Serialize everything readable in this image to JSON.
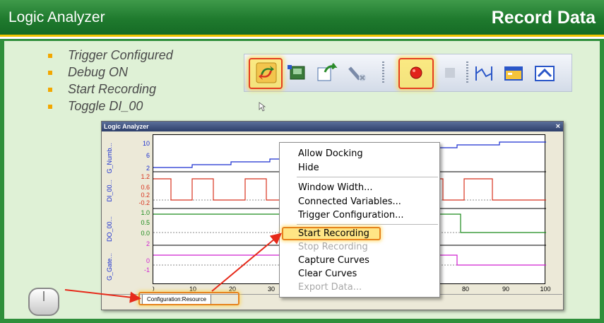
{
  "header": {
    "title_left": "Logic Analyzer",
    "title_right": "Record Data"
  },
  "bullets": [
    "Trigger Configured",
    "Debug ON",
    "Start Recording",
    "Toggle DI_00"
  ],
  "toolbar": {
    "icons": [
      "refresh-debug-icon",
      "download-icon",
      "connect-icon",
      "disconnect-icon",
      "record-icon",
      "stop-icon",
      "trigger-icon",
      "window-icon",
      "zoom-icon"
    ]
  },
  "logic_analyzer": {
    "window_title": "Logic Analyzer",
    "close_label": "×",
    "signals": [
      "G_Numb...",
      "DI_00...",
      "DO_00...",
      "G_Gate..."
    ],
    "y_ticks": [
      [
        "10",
        "6",
        "2"
      ],
      [
        "1.2",
        "0.6",
        "0.2",
        "-0.2"
      ],
      [
        "1.0",
        "0.5",
        "0.0"
      ],
      [
        "2",
        "0",
        "-1"
      ]
    ],
    "x_ticks": [
      "0",
      "10",
      "20",
      "30",
      "80",
      "90",
      "100"
    ],
    "tab_label": "Configuration:Resource"
  },
  "context_menu": {
    "items": [
      {
        "label": "Allow Docking",
        "enabled": true
      },
      {
        "label": "Hide",
        "enabled": true
      },
      {
        "label": "Window Width...",
        "enabled": true
      },
      {
        "label": "Connected Variables...",
        "enabled": true
      },
      {
        "label": "Trigger Configuration...",
        "enabled": true
      },
      {
        "label": "Start Recording",
        "enabled": true,
        "highlighted": true
      },
      {
        "label": "Stop Recording",
        "enabled": false
      },
      {
        "label": "Capture Curves",
        "enabled": true
      },
      {
        "label": "Clear Curves",
        "enabled": true
      },
      {
        "label": "Export Data...",
        "enabled": false
      }
    ]
  },
  "colors": {
    "header_green": "#1f7a2e",
    "accent_gold": "#f2c400",
    "highlight_red": "#e53d1f",
    "annotation_red": "#e62a1a"
  }
}
